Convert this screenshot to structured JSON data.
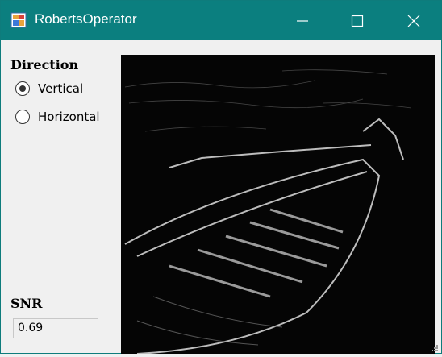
{
  "window": {
    "title": "RobertsOperator"
  },
  "direction": {
    "label": "Direction",
    "options": [
      {
        "label": "Vertical",
        "selected": true
      },
      {
        "label": "Horizontal",
        "selected": false
      }
    ]
  },
  "snr": {
    "label": "SNR",
    "value": "0.69"
  },
  "image": {
    "icon": "edge-detected-boat-image"
  },
  "colors": {
    "titlebar": "#0b7f7f",
    "background": "#f0f0f0",
    "image_background": "#000000"
  }
}
